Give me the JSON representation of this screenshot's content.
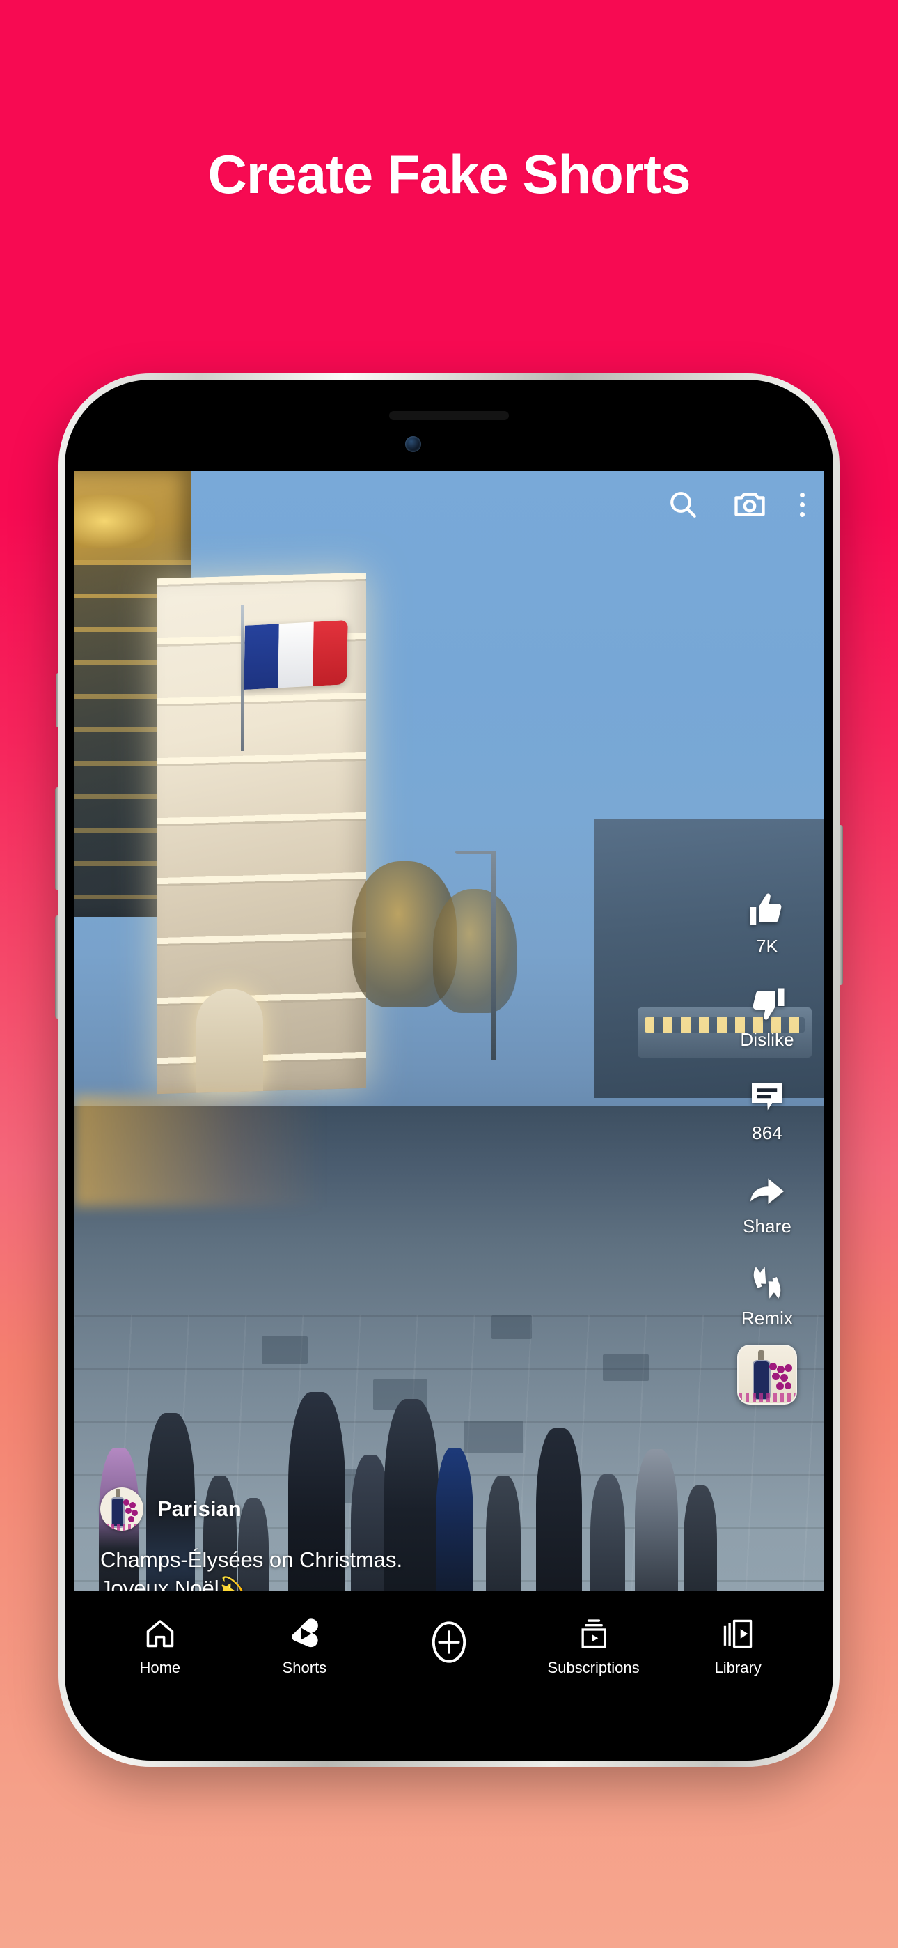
{
  "headline": "Create Fake Shorts",
  "colors": {
    "gradient_top": "#F70A52",
    "gradient_bottom": "#F6A68E",
    "overlay_text": "#FFFFFF",
    "nav_background": "#000000"
  },
  "phone": {
    "top_bar": {
      "search_icon": "search-icon",
      "camera_icon": "camera-icon",
      "more_icon": "more-vertical-icon"
    },
    "actions": [
      {
        "icon": "thumbs-up-icon",
        "label": "7K"
      },
      {
        "icon": "thumbs-down-icon",
        "label": "Dislike"
      },
      {
        "icon": "comment-icon",
        "label": "864"
      },
      {
        "icon": "share-arrow-icon",
        "label": "Share"
      },
      {
        "icon": "remix-icon",
        "label": "Remix"
      }
    ],
    "sound_thumbnail": "wine-bottle-grapes-thumbnail",
    "channel": {
      "avatar": "wine-bottle-grapes-avatar",
      "name": "Parisian"
    },
    "caption_line_1": "Champs-Élysées on Christmas.",
    "caption_line_2": "Joyeux Noël",
    "caption_emoji": "💫",
    "bottom_nav": [
      {
        "icon": "home-icon",
        "label": "Home",
        "active": false
      },
      {
        "icon": "shorts-icon",
        "label": "Shorts",
        "active": true
      },
      {
        "icon": "create-plus-icon",
        "label": "",
        "active": false
      },
      {
        "icon": "subscriptions-icon",
        "label": "Subscriptions",
        "active": false
      },
      {
        "icon": "library-icon",
        "label": "Library",
        "active": false
      }
    ]
  }
}
